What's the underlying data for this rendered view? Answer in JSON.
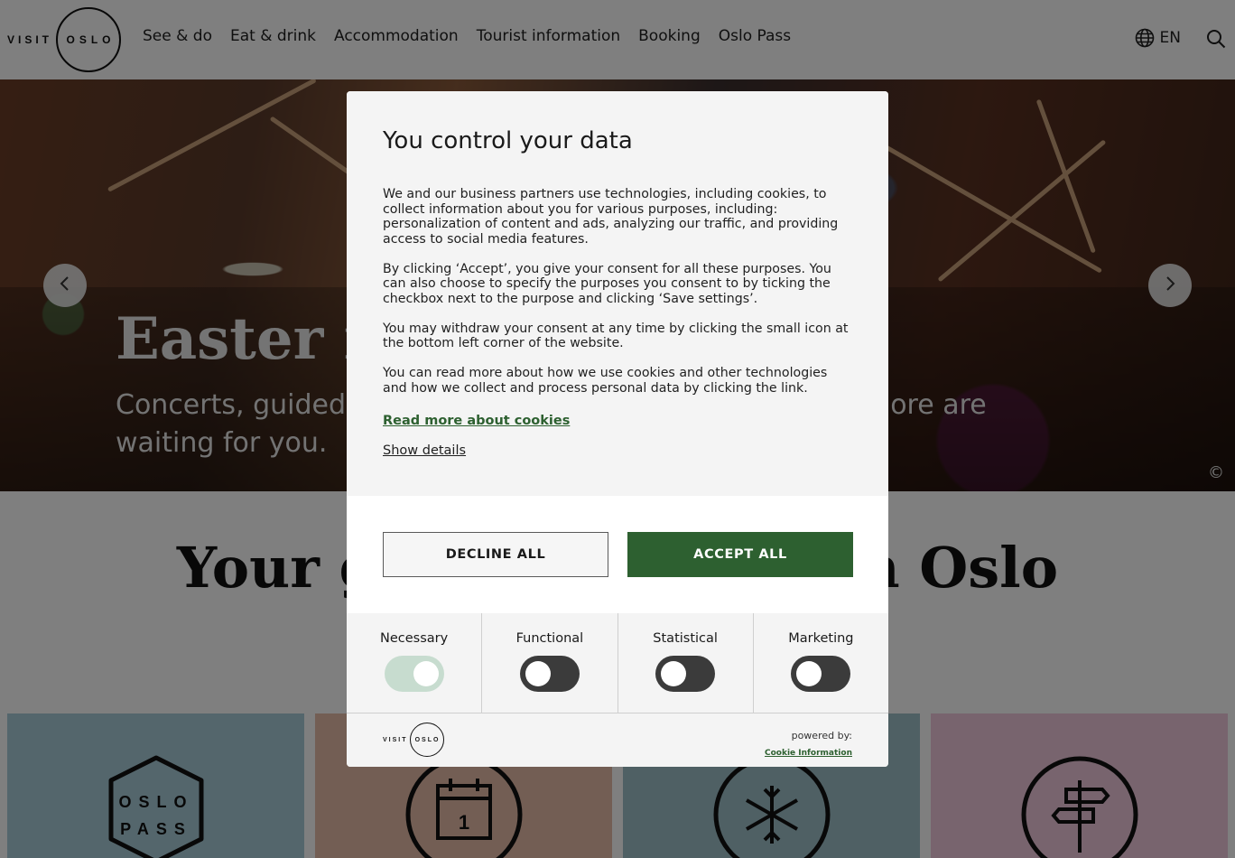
{
  "header": {
    "logo": {
      "visit": "VISIT",
      "oslo": "OSLO"
    },
    "nav": [
      "See & do",
      "Eat & drink",
      "Accommodation",
      "Tourist information",
      "Booking",
      "Oslo Pass"
    ],
    "language": "EN",
    "icons": {
      "language": "globe-icon",
      "search": "search-icon"
    }
  },
  "hero": {
    "title": "Easter in Oslo",
    "subtitle": "Concerts, guided tours, activities for kids and so much more are waiting for you.",
    "copyright": "©",
    "icons": {
      "prev": "chevron-left-icon",
      "next": "chevron-right-icon"
    }
  },
  "section": {
    "title": "Your guide to Easter in Oslo",
    "cards": [
      {
        "icon": "oslo-pass-icon",
        "color": "#a8ccd8",
        "badge_line1": "OSLO",
        "badge_line2": "PASS"
      },
      {
        "icon": "calendar-icon",
        "color": "#e6bca8",
        "calendar_day": "1"
      },
      {
        "icon": "snowflake-icon",
        "color": "#9ec1c9"
      },
      {
        "icon": "signpost-icon",
        "color": "#f0c9dc"
      }
    ]
  },
  "consent": {
    "title": "You control your data",
    "paragraphs": [
      "We and our business partners use technologies, including cookies, to collect information about you for various purposes, including: personalization of content and ads, analyzing our traffic, and providing access to social media features.",
      "By clicking ‘Accept’, you give your consent for all these purposes. You can also choose to specify the purposes you consent to by ticking the checkbox next to the purpose and clicking ‘Save settings’.",
      "You may withdraw your consent at any time by clicking the small icon at the bottom left corner of the website.",
      "You can read more about how we use cookies and other technologies and how we collect and process personal data by clicking the link."
    ],
    "read_more": "Read more about cookies",
    "show_details": "Show details",
    "decline": "DECLINE ALL",
    "accept": "ACCEPT ALL",
    "categories": [
      {
        "label": "Necessary",
        "enabled": true
      },
      {
        "label": "Functional",
        "enabled": false
      },
      {
        "label": "Statistical",
        "enabled": false
      },
      {
        "label": "Marketing",
        "enabled": false
      }
    ],
    "footer": {
      "logo_visit": "VISIT",
      "logo_oslo": "OSLO",
      "powered_by": "powered by:",
      "provider": "Cookie Information"
    },
    "colors": {
      "accent": "#2d6030",
      "overlay": "rgba(0,0,0,0.5)"
    }
  }
}
